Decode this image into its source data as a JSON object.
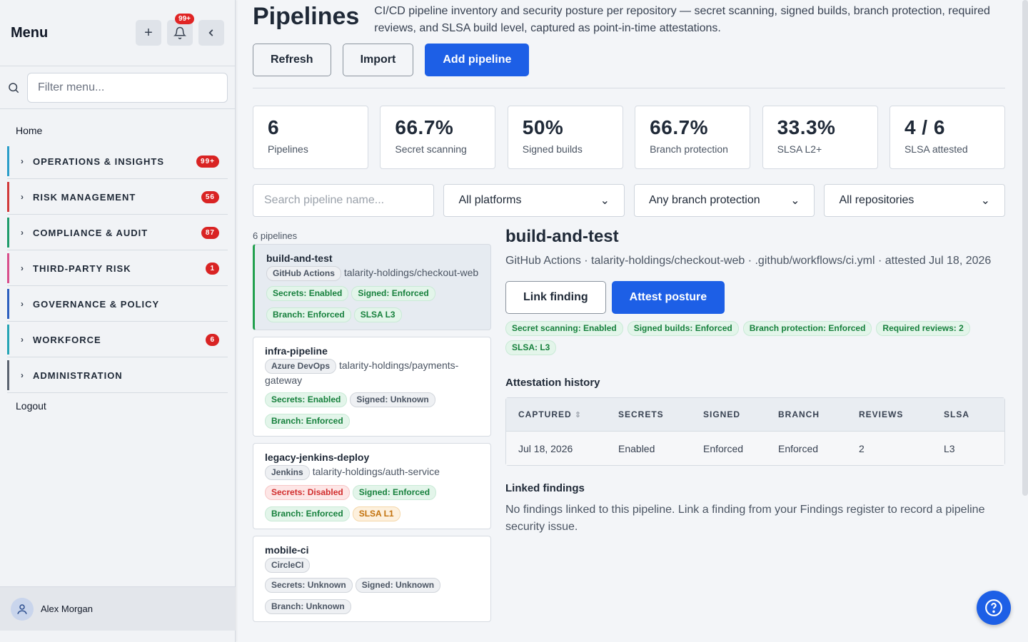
{
  "sidebar": {
    "title": "Menu",
    "notif_count": "99+",
    "filter_placeholder": "Filter menu...",
    "home": "Home",
    "items": [
      {
        "label": "OPERATIONS & INSIGHTS",
        "badge": "99+",
        "color": "#2b9ec9"
      },
      {
        "label": "RISK MANAGEMENT",
        "badge": "56",
        "color": "#d13a3a"
      },
      {
        "label": "COMPLIANCE & AUDIT",
        "badge": "87",
        "color": "#1f9c6b"
      },
      {
        "label": "THIRD-PARTY RISK",
        "badge": "1",
        "color": "#d94f8c"
      },
      {
        "label": "GOVERNANCE & POLICY",
        "badge": "",
        "color": "#2d5fbf"
      },
      {
        "label": "WORKFORCE",
        "badge": "6",
        "color": "#26a5b5"
      },
      {
        "label": "ADMINISTRATION",
        "badge": "",
        "color": "#5b6370"
      }
    ],
    "logout": "Logout",
    "user": "Alex Morgan"
  },
  "header": {
    "title": "Pipelines",
    "description": "CI/CD pipeline inventory and security posture per repository — secret scanning, signed builds, branch protection, required reviews, and SLSA build level, captured as point-in-time attestations.",
    "refresh": "Refresh",
    "import": "Import",
    "add": "Add pipeline"
  },
  "stats": [
    {
      "value": "6",
      "label": "Pipelines"
    },
    {
      "value": "66.7%",
      "label": "Secret scanning"
    },
    {
      "value": "50%",
      "label": "Signed builds"
    },
    {
      "value": "66.7%",
      "label": "Branch protection"
    },
    {
      "value": "33.3%",
      "label": "SLSA L2+"
    },
    {
      "value": "4 / 6",
      "label": "SLSA attested"
    }
  ],
  "filters": {
    "search_placeholder": "Search pipeline name...",
    "platform": "All platforms",
    "branch": "Any branch protection",
    "repo": "All repositories"
  },
  "list": {
    "count": "6 pipelines",
    "cards": [
      {
        "name": "build-and-test",
        "platform": "GitHub Actions",
        "repo": "talarity-holdings/checkout-web",
        "secrets": "Secrets: Enabled",
        "signed": "Signed: Enforced",
        "branch": "Branch: Enforced",
        "slsa": "SLSA L3"
      },
      {
        "name": "infra-pipeline",
        "platform": "Azure DevOps",
        "repo": "talarity-holdings/payments-gateway",
        "secrets": "Secrets: Enabled",
        "signed": "Signed: Unknown",
        "branch": "Branch: Enforced",
        "slsa": ""
      },
      {
        "name": "legacy-jenkins-deploy",
        "platform": "Jenkins",
        "repo": "talarity-holdings/auth-service",
        "secrets": "Secrets: Disabled",
        "signed": "Signed: Enforced",
        "branch": "Branch: Enforced",
        "slsa": "SLSA L1"
      },
      {
        "name": "mobile-ci",
        "platform": "CircleCI",
        "repo": "",
        "secrets": "Secrets: Unknown",
        "signed": "Signed: Unknown",
        "branch": "Branch: Unknown",
        "slsa": ""
      }
    ]
  },
  "detail": {
    "title": "build-and-test",
    "subtitle": "GitHub Actions · talarity-holdings/checkout-web · .github/workflows/ci.yml · attested Jul 18, 2026",
    "link_finding": "Link finding",
    "attest": "Attest posture",
    "pills": [
      "Secret scanning: Enabled",
      "Signed builds: Enforced",
      "Branch protection: Enforced",
      "Required reviews: 2",
      "SLSA: L3"
    ],
    "history_title": "Attestation history",
    "columns": [
      "CAPTURED",
      "SECRETS",
      "SIGNED",
      "BRANCH",
      "REVIEWS",
      "SLSA"
    ],
    "rows": [
      [
        "Jul 18, 2026",
        "Enabled",
        "Enforced",
        "Enforced",
        "2",
        "L3"
      ]
    ],
    "findings_title": "Linked findings",
    "findings_text": "No findings linked to this pipeline. Link a finding from your Findings register to record a pipeline security issue."
  }
}
